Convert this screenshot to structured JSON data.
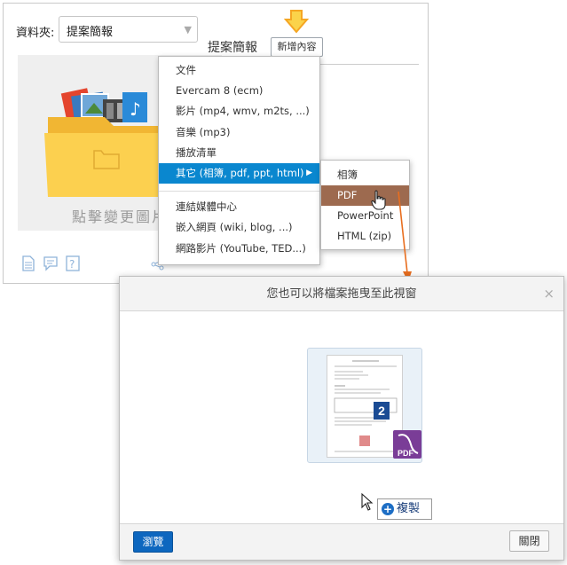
{
  "panel": {
    "folder_label": "資料夾:",
    "folder_select_value": "提案簡報",
    "section_title": "提案簡報",
    "add_button": "新增內容",
    "preview_caption": "點擊變更圖片"
  },
  "menu": {
    "items": [
      "文件",
      "Evercam 8 (ecm)",
      "影片 (mp4, wmv, m2ts, ...)",
      "音樂 (mp3)",
      "播放清單",
      "其它 (相簿, pdf, ppt, html)",
      "連結媒體中心",
      "嵌入網頁 (wiki, blog, ...)",
      "網路影片 (YouTube, TED...)"
    ]
  },
  "submenu": {
    "items": [
      "相簿",
      "PDF",
      "PowerPoint",
      "HTML (zip)"
    ]
  },
  "dialog": {
    "title": "您也可以將檔案拖曳至此視窗",
    "close_symbol": "×",
    "page_count": "2",
    "copy_label": "複製",
    "browse_button": "瀏覽",
    "close_button": "關閉"
  },
  "colors": {
    "menu_active": "#0a87cf",
    "submenu_active": "#9d6a4f",
    "browse_button": "#0d67bf",
    "hint_arrow": "#f5a623",
    "drag_arrow": "#e86e1f"
  }
}
